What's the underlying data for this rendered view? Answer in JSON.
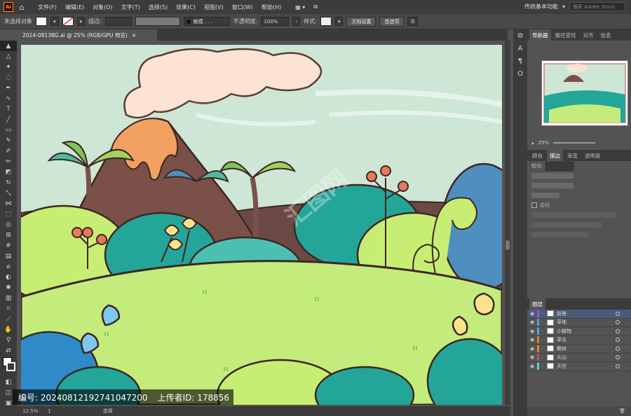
{
  "app": {
    "logo": "Ai",
    "workspace": "传统基本功能",
    "search_placeholder": "搜索 Adobe Stock"
  },
  "menu": [
    "文件(F)",
    "编辑(E)",
    "对象(O)",
    "文字(T)",
    "选择(S)",
    "效果(C)",
    "视图(V)",
    "窗口(W)",
    "帮助(H)"
  ],
  "control_bar": {
    "selection_label": "未选择对象",
    "stroke_label": "描边:",
    "brush_label": "触摸 . . .",
    "opacity_label": "不透明度:",
    "opacity_value": "100%",
    "style_label": "样式:",
    "doc_setup_button": "文档设置",
    "prefs_button": "首选项"
  },
  "document_tab": {
    "title": "2024-0813BG.ai @ 25% (RGB/GPU 预览)",
    "close": "×"
  },
  "status_bar": {
    "zoom": "12.5%",
    "artboard": "1",
    "tool": "选择"
  },
  "watermark": {
    "id_label": "编号:",
    "id_value": "20240812192741047200",
    "uploader_label": "上传者ID:",
    "uploader_value": "178856"
  },
  "right_panel": {
    "top_tabs": [
      "导航器",
      "路径查找",
      "对齐",
      "信息"
    ],
    "nav_zoom": "25%",
    "mid_tabs": [
      "颜色",
      "描边",
      "渐变",
      "透明度"
    ],
    "stroke_weight_label": "粗细:",
    "dashed_label": "虚线",
    "layers_tab": "图层",
    "layers": [
      {
        "name": "前景",
        "color": "#b14cd8",
        "selected": true
      },
      {
        "name": "草地",
        "color": "#4aa8d8",
        "selected": false
      },
      {
        "name": "小植物",
        "color": "#4aa8d8",
        "selected": false
      },
      {
        "name": "草丛",
        "color": "#e0832a",
        "selected": false
      },
      {
        "name": "椰树",
        "color": "#e0832a",
        "selected": false
      },
      {
        "name": "火山",
        "color": "#d24a4a",
        "selected": false
      },
      {
        "name": "天空",
        "color": "#4ad8c8",
        "selected": false
      }
    ]
  },
  "tools": [
    "selection-tool",
    "direct-select-tool",
    "magic-wand-tool",
    "lasso-tool",
    "pen-tool",
    "curvature-tool",
    "type-tool",
    "line-tool",
    "rectangle-tool",
    "paintbrush-tool",
    "shaper-tool",
    "pencil-tool",
    "eraser-tool",
    "rotate-tool",
    "scale-tool",
    "width-tool",
    "free-transform-tool",
    "shape-builder-tool",
    "perspective-tool",
    "mesh-tool",
    "gradient-tool",
    "eyedropper-tool",
    "blend-tool",
    "symbol-sprayer-tool",
    "column-graph-tool",
    "artboard-tool",
    "slice-tool",
    "hand-tool",
    "zoom-tool"
  ]
}
